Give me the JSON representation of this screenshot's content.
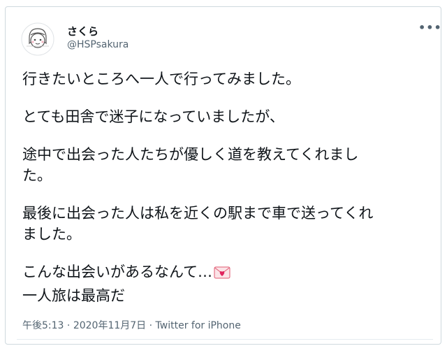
{
  "user": {
    "display_name": "さくら",
    "handle": "@HSPsakura",
    "avatar_icon": "sakura-face-avatar-icon"
  },
  "menu_icon": "more-options-icon",
  "tweet": {
    "lines": [
      "行きたいところへ一人で行ってみました。",
      "",
      "とても田舎で迷子になっていましたが、",
      "",
      "途中で出会った人たちが優しく道を教えてくれまし",
      "た。",
      "",
      "最後に出会った人は私を近くの駅まで車で送ってくれ",
      "ました。",
      "",
      "こんな出会いがあるなんて…",
      "一人旅は最高だ"
    ],
    "emoji_icon": "love-letter-emoji-icon"
  },
  "meta": {
    "time": "午後5:13",
    "separator": " · ",
    "date": "2020年11月7日",
    "source": "Twitter for iPhone"
  }
}
